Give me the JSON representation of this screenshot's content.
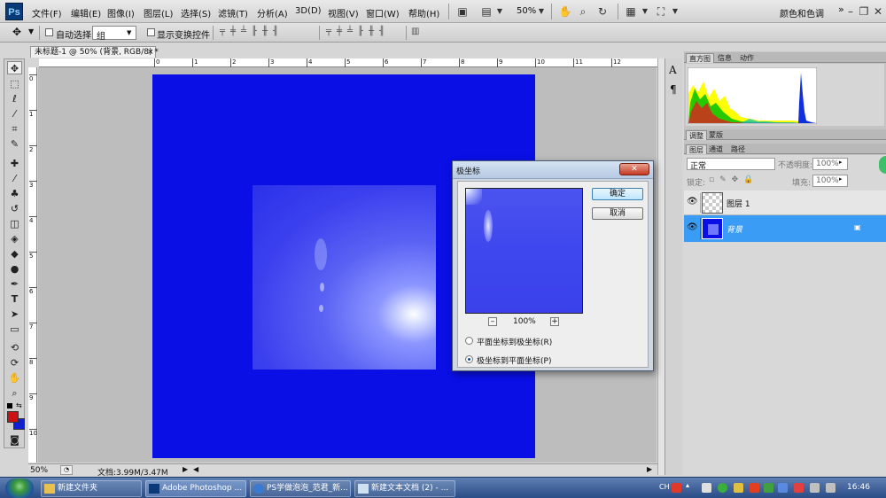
{
  "app": {
    "logo": "Ps"
  },
  "menu": [
    "文件(F)",
    "编辑(E)",
    "图像(I)",
    "图层(L)",
    "选择(S)",
    "滤镜(T)",
    "分析(A)",
    "3D(D)",
    "视图(V)",
    "窗口(W)",
    "帮助(H)"
  ],
  "menubar_right": {
    "zoom": "50%",
    "workspace": "颜色和色调"
  },
  "options": {
    "auto_select_label": "自动选择:",
    "auto_select_value": "组",
    "show_transform_label": "显示变换控件"
  },
  "document": {
    "tab_title": "未标题-1 @ 50% (背景, RGB/8) *",
    "zoom": "50%",
    "doc_info": "文档:3.99M/3.47M"
  },
  "ruler_h": [
    "0",
    "1",
    "2",
    "3",
    "4",
    "5",
    "6",
    "7",
    "8",
    "9",
    "10",
    "11",
    "12"
  ],
  "ruler_v": [
    "0",
    "1",
    "2",
    "3",
    "4",
    "5",
    "6",
    "7",
    "8",
    "9",
    "10",
    "11"
  ],
  "panels": {
    "top_tabs": [
      "直方图",
      "信息",
      "动作"
    ],
    "adjust_tabs": [
      "调整",
      "蒙版"
    ],
    "layer_tabs": [
      "图层",
      "通道",
      "路径"
    ],
    "blend_mode": "正常",
    "opacity_label": "不透明度:",
    "opacity_value": "100%",
    "lock_label": "锁定:",
    "fill_label": "填充:",
    "fill_value": "100%",
    "layers": [
      {
        "name": "图层 1",
        "selected": false
      },
      {
        "name": "背景",
        "selected": true
      }
    ]
  },
  "dialog": {
    "title": "极坐标",
    "ok": "确定",
    "cancel": "取消",
    "zoom": "100%",
    "options": [
      {
        "label": "平面坐标到极坐标(R)",
        "checked": false
      },
      {
        "label": "极坐标到平面坐标(P)",
        "checked": true
      }
    ]
  },
  "taskbar": {
    "buttons": [
      "新建文件夹",
      "Adobe Photoshop ...",
      "PS学做泡泡_范君_新...",
      "新建文本文档 (2) - ..."
    ],
    "lang": "CH",
    "clock": "16:46"
  },
  "colors": {
    "canvas": "#0a0fe6",
    "foreground": "#cc1111",
    "background": "#1020d0",
    "layer_selected": "#3b9cf5"
  }
}
